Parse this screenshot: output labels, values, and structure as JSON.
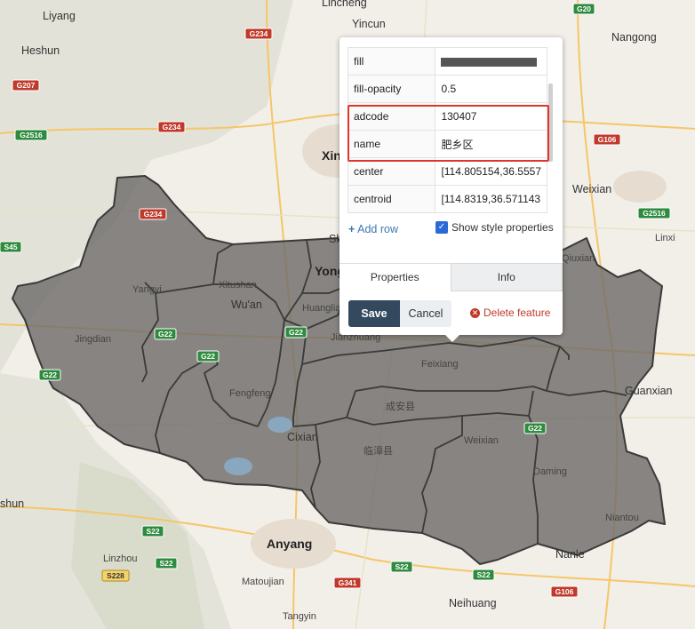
{
  "map": {
    "cities": [
      {
        "name": "Liyang",
        "cls": "city-md"
      },
      {
        "name": "Heshun",
        "cls": "city-md"
      },
      {
        "name": "Lincheng",
        "cls": "city-md"
      },
      {
        "name": "Yincun",
        "cls": "city-md"
      },
      {
        "name": "Nangong",
        "cls": "city-md"
      },
      {
        "name": "Xin",
        "cls": "city-lg"
      },
      {
        "name": "Weixian",
        "cls": "city-md"
      },
      {
        "name": "Linxi",
        "cls": "city-sm"
      },
      {
        "name": "Jingdian",
        "cls": "city-sm"
      },
      {
        "name": "Yangyi",
        "cls": "city-sm"
      },
      {
        "name": "Xitushan",
        "cls": "city-sm"
      },
      {
        "name": "Wu'an",
        "cls": "city-md"
      },
      {
        "name": "Yong",
        "cls": "city-lg"
      },
      {
        "name": "Huanglia",
        "cls": "city-sm"
      },
      {
        "name": "Jianzhuang",
        "cls": "city-sm"
      },
      {
        "name": "Feixiang",
        "cls": "city-sm"
      },
      {
        "name": "Qiuxian",
        "cls": "city-sm"
      },
      {
        "name": "Guanxian",
        "cls": "city-md"
      },
      {
        "name": "Fengfeng",
        "cls": "city-sm"
      },
      {
        "name": "成安县",
        "cls": "city-sm"
      },
      {
        "name": "Cixian",
        "cls": "city-md"
      },
      {
        "name": "Weixian",
        "cls": "city-sm"
      },
      {
        "name": "临漳县",
        "cls": "city-sm"
      },
      {
        "name": "Daming",
        "cls": "city-sm"
      },
      {
        "name": "Niantou",
        "cls": "city-sm"
      },
      {
        "name": "Anyang",
        "cls": "city-lg"
      },
      {
        "name": "Nanle",
        "cls": "city-md"
      },
      {
        "name": "Linzhou",
        "cls": "city-sm"
      },
      {
        "name": "Matoujian",
        "cls": "city-sm"
      },
      {
        "name": "Neihuang",
        "cls": "city-md"
      },
      {
        "name": "Tangyin",
        "cls": "city-sm"
      },
      {
        "name": "shun",
        "cls": "city-md"
      },
      {
        "name": "Sh",
        "cls": "city-md"
      }
    ],
    "shields": [
      {
        "label": "G234",
        "color": "r"
      },
      {
        "label": "G207",
        "color": "r"
      },
      {
        "label": "G2516",
        "color": "g"
      },
      {
        "label": "G234",
        "color": "r"
      },
      {
        "label": "G20",
        "color": "g"
      },
      {
        "label": "G106",
        "color": "r"
      },
      {
        "label": "G2516",
        "color": "g"
      },
      {
        "label": "S45",
        "color": "g"
      },
      {
        "label": "G234",
        "color": "r"
      },
      {
        "label": "G22",
        "color": "g"
      },
      {
        "label": "G22",
        "color": "g"
      },
      {
        "label": "G22",
        "color": "g"
      },
      {
        "label": "G22",
        "color": "g"
      },
      {
        "label": "G22",
        "color": "g"
      },
      {
        "label": "S22",
        "color": "g"
      },
      {
        "label": "S22",
        "color": "g"
      },
      {
        "label": "S228",
        "color": "y"
      },
      {
        "label": "S22",
        "color": "g"
      },
      {
        "label": "G341",
        "color": "r"
      },
      {
        "label": "S22",
        "color": "g"
      },
      {
        "label": "G106",
        "color": "r"
      }
    ]
  },
  "popup": {
    "properties": [
      {
        "key": "fill",
        "value": "",
        "swatch": true
      },
      {
        "key": "fill-opacity",
        "value": "0.5"
      },
      {
        "key": "adcode",
        "value": "130407"
      },
      {
        "key": "name",
        "value": "肥乡区"
      },
      {
        "key": "center",
        "value": "[114.805154,36.5557"
      },
      {
        "key": "centroid",
        "value": "[114.8319,36.571143"
      }
    ],
    "fill_color": "#555555",
    "add_row_label": "Add row",
    "show_style_label": "Show style properties",
    "show_style_checked": true,
    "tabs": [
      {
        "label": "Properties",
        "active": true
      },
      {
        "label": "Info",
        "active": false
      }
    ],
    "save_label": "Save",
    "cancel_label": "Cancel",
    "delete_label": "Delete feature",
    "highlight_color": "#e0352b"
  }
}
